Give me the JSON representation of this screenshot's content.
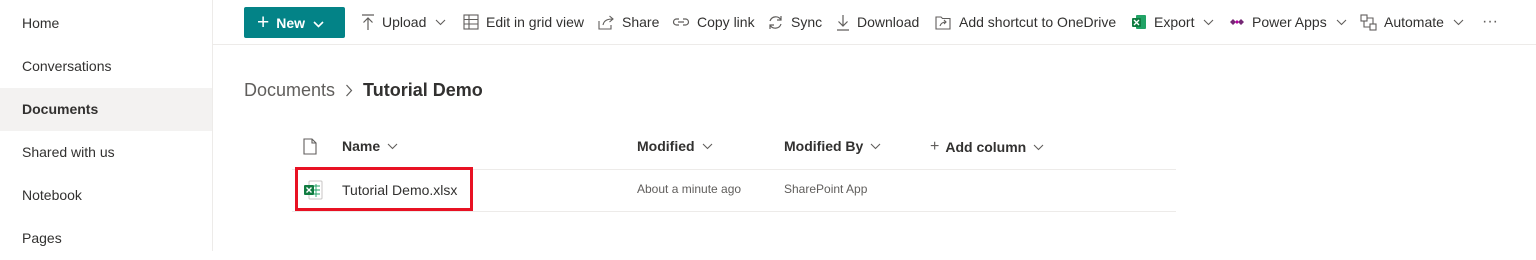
{
  "sidebar": {
    "items": [
      {
        "label": "Home"
      },
      {
        "label": "Conversations"
      },
      {
        "label": "Documents",
        "selected": true
      },
      {
        "label": "Shared with us"
      },
      {
        "label": "Notebook"
      },
      {
        "label": "Pages"
      }
    ]
  },
  "toolbar": {
    "new_label": "New",
    "upload_label": "Upload",
    "grid_label": "Edit in grid view",
    "share_label": "Share",
    "copylink_label": "Copy link",
    "sync_label": "Sync",
    "download_label": "Download",
    "shortcut_label": "Add shortcut to OneDrive",
    "export_label": "Export",
    "powerapps_label": "Power Apps",
    "automate_label": "Automate",
    "more_label": "···"
  },
  "breadcrumb": {
    "root": "Documents",
    "current": "Tutorial Demo"
  },
  "list": {
    "headers": {
      "name": "Name",
      "modified": "Modified",
      "modified_by": "Modified By",
      "add_column": "Add column"
    },
    "rows": [
      {
        "name": "Tutorial Demo.xlsx",
        "modified": "About a minute ago",
        "modified_by": "SharePoint App",
        "icon": "excel-file-icon"
      }
    ]
  },
  "colors": {
    "accent": "#038387",
    "excel": "#107c41",
    "highlight": "#e81123",
    "selected_nav": "#f3f2f1"
  }
}
